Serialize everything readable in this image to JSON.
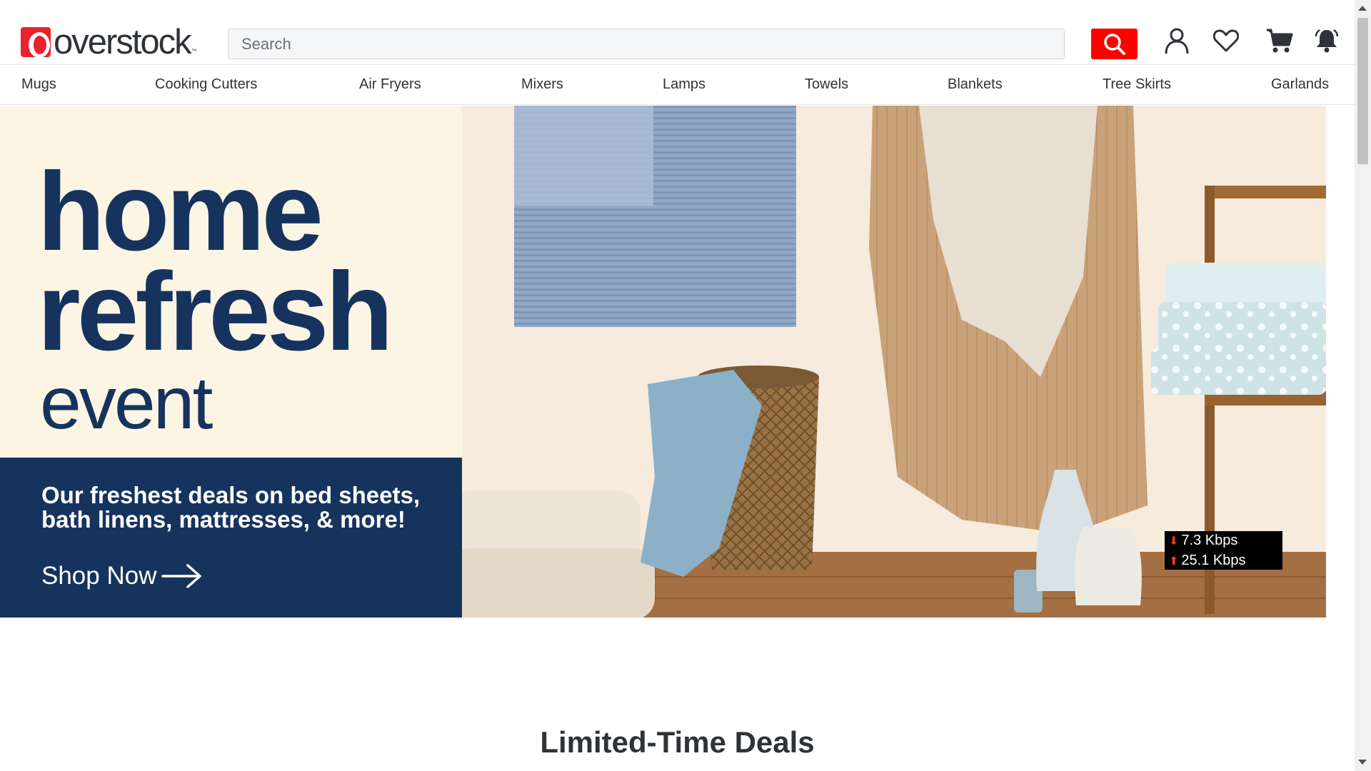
{
  "brand": {
    "name": "overstock",
    "trademark": "™"
  },
  "search": {
    "placeholder": "Search"
  },
  "header_icons": [
    "search-icon",
    "account-icon",
    "heart-icon",
    "cart-icon",
    "bell-icon"
  ],
  "categories": [
    "Mugs",
    "Cooking Cutters",
    "Air Fryers",
    "Mixers",
    "Lamps",
    "Towels",
    "Blankets",
    "Tree Skirts",
    "Garlands"
  ],
  "hero": {
    "line1": "home",
    "line2": "refresh",
    "line3": "event",
    "tagline": "Our freshest deals on bed sheets, bath linens, mattresses, & more!",
    "cta": "Shop Now"
  },
  "net_monitor": {
    "down": "7.3 Kbps",
    "up": "25.1 Kbps"
  },
  "section": {
    "title": "Limited-Time Deals"
  },
  "colors": {
    "brand_red": "#ff0000",
    "navy": "#16335e",
    "cream": "#fdf5e4",
    "text": "#2f3337"
  }
}
